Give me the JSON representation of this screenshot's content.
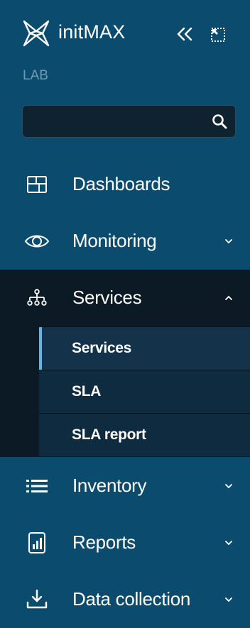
{
  "header": {
    "brand": "initMAX",
    "server_name": "LAB"
  },
  "search": {
    "placeholder": "",
    "value": ""
  },
  "menu": {
    "dashboards": {
      "label": "Dashboards"
    },
    "monitoring": {
      "label": "Monitoring"
    },
    "services": {
      "label": "Services",
      "submenu": [
        {
          "label": "Services"
        },
        {
          "label": "SLA"
        },
        {
          "label": "SLA report"
        }
      ]
    },
    "inventory": {
      "label": "Inventory"
    },
    "reports": {
      "label": "Reports"
    },
    "data_collection": {
      "label": "Data collection"
    }
  },
  "colors": {
    "sidebar_bg": "#0b4c6e",
    "active_group_bg": "#0c1a25",
    "submenu_active_bg": "#14324a",
    "submenu_bg": "#0f2b40",
    "active_indicator": "#5fb6e8"
  }
}
